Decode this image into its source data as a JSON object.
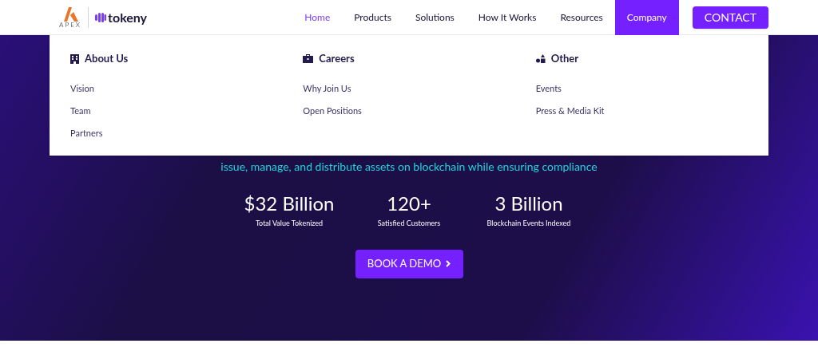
{
  "logo": {
    "brand": "APEX",
    "partner": "tokeny"
  },
  "nav": [
    {
      "label": "Home",
      "selected": true,
      "expanded": false
    },
    {
      "label": "Products",
      "selected": false,
      "expanded": false
    },
    {
      "label": "Solutions",
      "selected": false,
      "expanded": false
    },
    {
      "label": "How It Works",
      "selected": false,
      "expanded": false
    },
    {
      "label": "Resources",
      "selected": false,
      "expanded": false
    },
    {
      "label": "Company",
      "selected": false,
      "expanded": true
    }
  ],
  "contact_button": "CONTACT",
  "dropdown": [
    {
      "heading": "About Us",
      "kind": "building",
      "links": [
        "Vision",
        "Team",
        "Partners"
      ]
    },
    {
      "heading": "Careers",
      "kind": "briefcase",
      "links": [
        "Why Join Us",
        "Open Positions"
      ]
    },
    {
      "heading": "Other",
      "kind": "shapes",
      "links": [
        "Events",
        "Press & Media Kit"
      ]
    }
  ],
  "hero": {
    "tagline": "issue, manage, and distribute assets on blockchain while ensuring compliance",
    "stats": [
      {
        "value": "$32 Billion",
        "label": "Total Value Tokenized"
      },
      {
        "value": "120+",
        "label": "Satisfied Customers"
      },
      {
        "value": "3 Billion",
        "label": "Blockchain Events Indexed"
      }
    ],
    "cta": "BOOK A DEMO"
  }
}
